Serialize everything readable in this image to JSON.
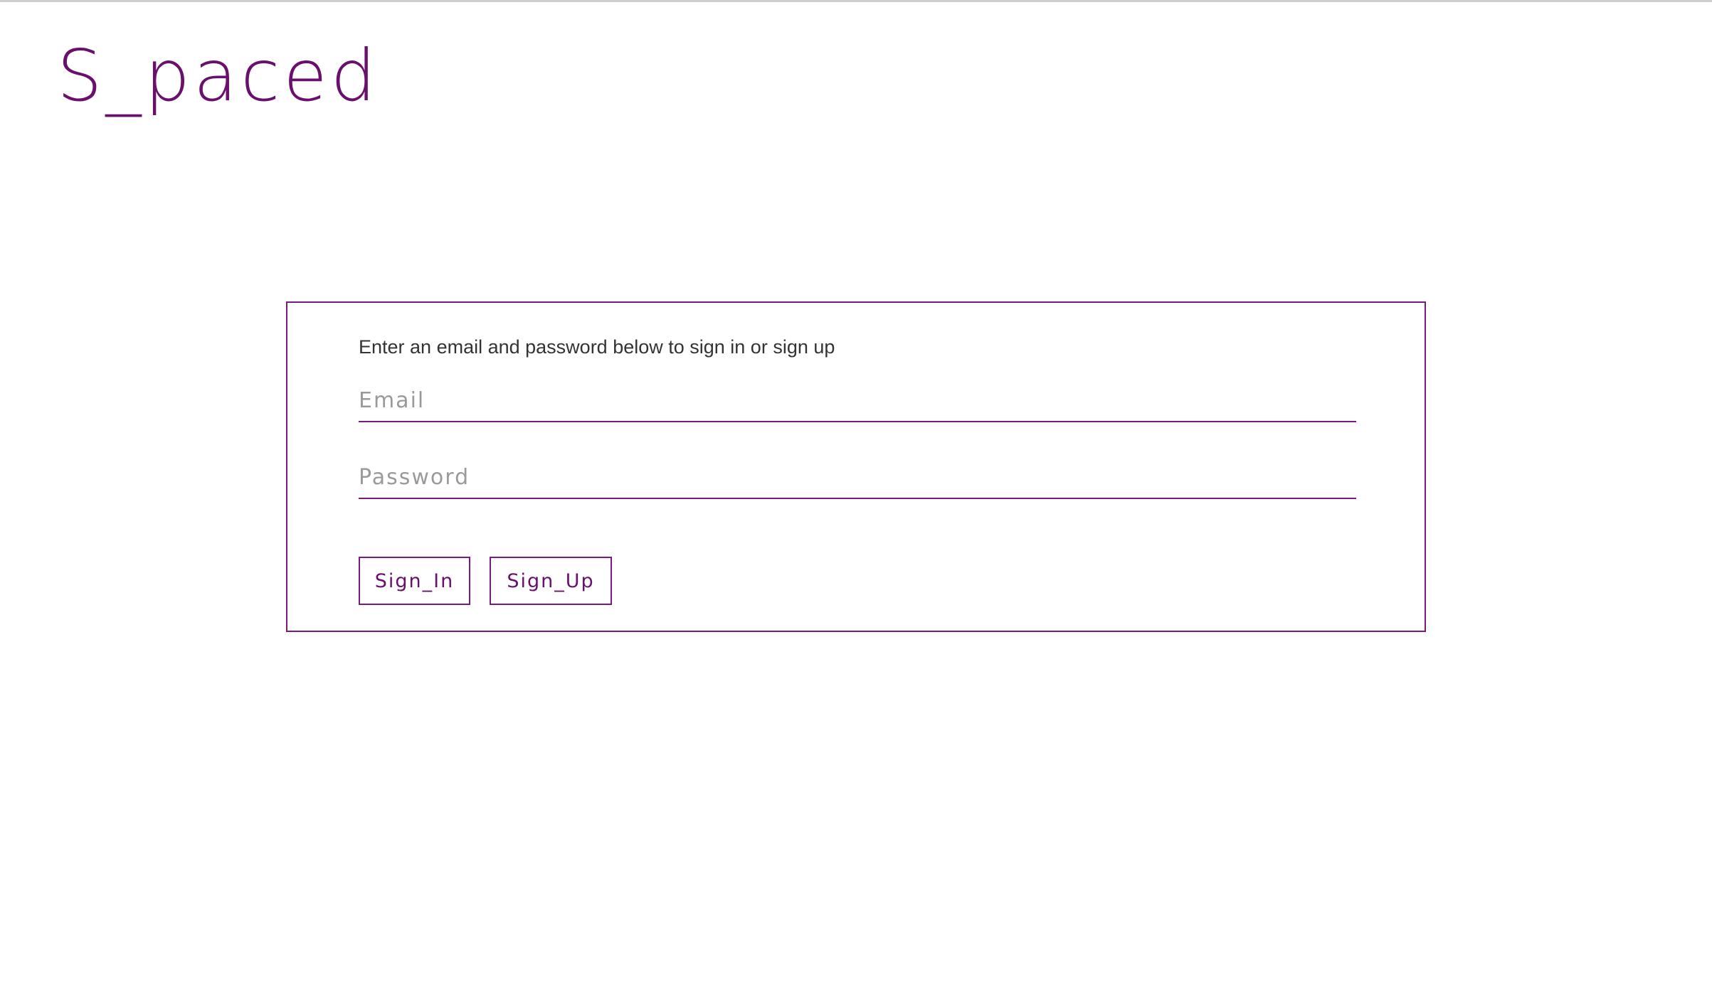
{
  "app": {
    "logo_text": "S_paced"
  },
  "auth_card": {
    "instruction": "Enter an email and password below to sign in or sign up",
    "email_field": {
      "placeholder": "Email",
      "value": ""
    },
    "password_field": {
      "placeholder": "Password",
      "value": ""
    },
    "sign_in_label": "Sign_In",
    "sign_up_label": "Sign_Up"
  },
  "colors": {
    "accent": "#6a0f6e",
    "border": "#7a1a7e",
    "text": "#333333",
    "placeholder": "#9a9a9a",
    "background": "#ffffff"
  }
}
